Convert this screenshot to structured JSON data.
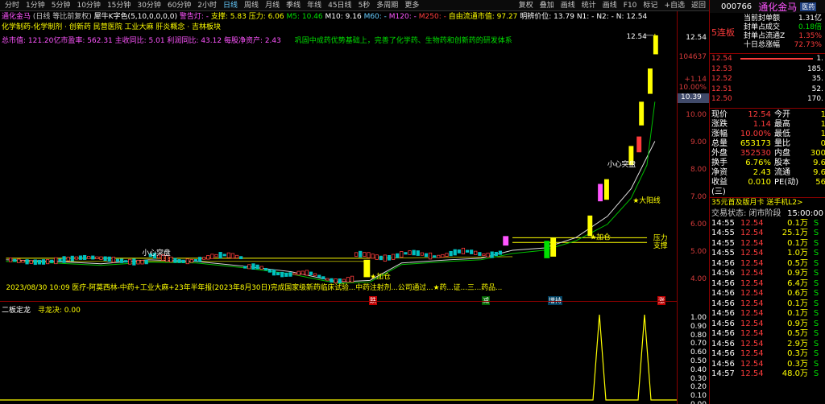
{
  "toolbar": {
    "periods": [
      "分时",
      "1分钟",
      "5分钟",
      "10分钟",
      "15分钟",
      "30分钟",
      "60分钟",
      "2小时",
      "日线",
      "周线",
      "月线",
      "季线",
      "年线",
      "45日线",
      "5秒",
      "多周期",
      "更多"
    ],
    "active_period": "日线",
    "right_items": [
      "复权",
      "叠加",
      "画线",
      "统计",
      "画线",
      "F10",
      "标记",
      "+自选",
      "返回"
    ]
  },
  "info1": {
    "name": "通化金马",
    "mode": "(日线 等比前复权)",
    "indicator": "犀牛K字色(5,10,0,0,0,0)",
    "alert": "警告灯: -",
    "support": "支撑: 5.83",
    "pressure": "压力: 6.06",
    "m5": "M5: 10.46",
    "m10": "M10: 9.16",
    "m60": "M60: -",
    "m120": "M120: -",
    "m250": "M250: -",
    "free_float": "自由流通市值: 97.27",
    "cost": "明辨价位: 13.79",
    "n1": "N1: -",
    "n2": "N2: -",
    "n": "N: 12.54"
  },
  "info2": {
    "concepts": "化学制药-化学制剂 · 创新药 民营医院 工业大麻 肝炎概念 · 吉林板块"
  },
  "info3": {
    "left": "总市值: 121.20亿市盈率: 562.31 主收同比: 5.01 利润同比: 43.12 每股净资产: 2.43",
    "right": "巩固中成药优势基础上，完善了化学药、生物药和创新药的研发体系"
  },
  "chart": {
    "price_top_label": "12.54",
    "vol_label": "104637",
    "annotations": {
      "heart_left": "小心突盘",
      "heart_right": "小心突盘",
      "big_up": "★大阳线",
      "add_pos1": "★加仓",
      "add_pos2": "★加仓",
      "pressure": "压力",
      "support": "支撑"
    },
    "news_line": "2023/08/30 10:09 医疗-阿莫西林-中药+工业大麻+23年半年报(2023年8月30日)完成国家级新药临床试验...中药注射剂...公司通过...★药...证...三...药品...",
    "news_tags": [
      "跌",
      "减",
      "增持",
      "涨"
    ]
  },
  "yaxis": {
    "ticks": [
      "12.54",
      "10.00",
      "9.00",
      "8.00",
      "7.00",
      "6.00",
      "5.00",
      "4.00"
    ],
    "sub_ticks": [
      "1.00",
      "0.90",
      "0.80",
      "0.70",
      "0.60",
      "0.50",
      "0.40",
      "0.30",
      "0.20",
      "0.10",
      "0.00"
    ],
    "price_boxes": [
      {
        "label": "+1.14",
        "color": "#ff3c3c"
      },
      {
        "label": "10.00%",
        "color": "#ff3c3c"
      },
      {
        "label": "10.39",
        "color": "#ffffff"
      }
    ]
  },
  "sub_indicator": {
    "name": "二板定龙",
    "value_label": "寻龙决: 0.00"
  },
  "right_panel": {
    "code": "000766",
    "name": "通化金马",
    "badge": "医药",
    "streak": "5连板",
    "seal": [
      {
        "label": "当前封单额",
        "value": "1.31亿",
        "color": "#ffffff"
      },
      {
        "label": "封单占成交",
        "value": "0.18倍",
        "color": "#00e000"
      },
      {
        "label": "封单占流通Z",
        "value": "1.35%",
        "color": "#ff3c3c"
      },
      {
        "label": "十日总涨幅",
        "value": "72.73%",
        "color": "#ff3c3c"
      }
    ],
    "order_book": [
      {
        "price": "12.54",
        "vol": "1."
      },
      {
        "price": "12.53",
        "vol": "185."
      },
      {
        "price": "12.52",
        "vol": "35."
      },
      {
        "price": "12.51",
        "vol": "52."
      },
      {
        "price": "12.50",
        "vol": "170."
      }
    ],
    "stats": [
      {
        "l1": "现价",
        "v1": "12.54",
        "l2": "今开",
        "v2": "1"
      },
      {
        "l1": "涨跌",
        "v1": "1.14",
        "l2": "最高",
        "v2": "1"
      },
      {
        "l1": "涨幅",
        "v1": "10.00%",
        "l2": "最低",
        "v2": "1"
      },
      {
        "l1": "总量",
        "v1": "653173",
        "l2": "量比",
        "v2": "0"
      },
      {
        "l1": "外盘",
        "v1": "352530",
        "l2": "内盘",
        "v2": "300"
      },
      {
        "l1": "换手",
        "v1": "6.76%",
        "l2": "股本",
        "v2": "9.6"
      },
      {
        "l1": "净资",
        "v1": "2.43",
        "l2": "流通",
        "v2": "9.6"
      },
      {
        "l1": "收益(三)",
        "v1": "0.010",
        "l2": "PE(动)",
        "v2": "56"
      }
    ],
    "promo": "35元首及版月卡 送手机L2>",
    "trade_status": "交易状态: 闭市阶段",
    "trade_time": "15:00:00",
    "ticks": [
      {
        "t": "14:55",
        "p": "12.54",
        "v": "0.1万",
        "d": "S"
      },
      {
        "t": "14:55",
        "p": "12.54",
        "v": "25.1万",
        "d": "S"
      },
      {
        "t": "14:55",
        "p": "12.54",
        "v": "0.1万",
        "d": "S"
      },
      {
        "t": "14:55",
        "p": "12.54",
        "v": "1.0万",
        "d": "S"
      },
      {
        "t": "14:56",
        "p": "12.54",
        "v": "0.5万",
        "d": "S"
      },
      {
        "t": "14:56",
        "p": "12.54",
        "v": "0.9万",
        "d": "S"
      },
      {
        "t": "14:56",
        "p": "12.54",
        "v": "6.4万",
        "d": "S"
      },
      {
        "t": "14:56",
        "p": "12.54",
        "v": "0.6万",
        "d": "S"
      },
      {
        "t": "14:56",
        "p": "12.54",
        "v": "0.1万",
        "d": "S"
      },
      {
        "t": "14:56",
        "p": "12.54",
        "v": "0.1万",
        "d": "S"
      },
      {
        "t": "14:56",
        "p": "12.54",
        "v": "0.9万",
        "d": "S"
      },
      {
        "t": "14:56",
        "p": "12.54",
        "v": "0.5万",
        "d": "S"
      },
      {
        "t": "14:56",
        "p": "12.54",
        "v": "2.9万",
        "d": "S"
      },
      {
        "t": "14:56",
        "p": "12.54",
        "v": "0.3万",
        "d": "S"
      },
      {
        "t": "14:56",
        "p": "12.54",
        "v": "0.3万",
        "d": "S"
      },
      {
        "t": "14:57",
        "p": "12.54",
        "v": "48.0万",
        "d": "S"
      }
    ]
  }
}
